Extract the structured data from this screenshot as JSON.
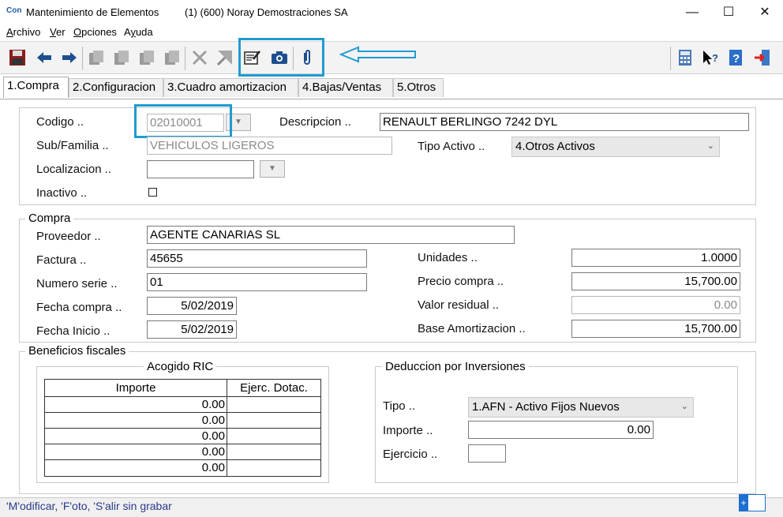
{
  "window": {
    "app_icon_text": "Con",
    "title": "Mantenimiento de Elementos",
    "company": "(1)    (600) Noray Demostraciones SA",
    "minimize": "—",
    "maximize": "☐",
    "close": "✕"
  },
  "menu": {
    "items": [
      {
        "label": "Archivo",
        "underline": "A"
      },
      {
        "label": "Ver",
        "underline": "V"
      },
      {
        "label": "Opciones",
        "underline": "O"
      },
      {
        "label": "Ayuda",
        "underline": "y"
      }
    ]
  },
  "toolbar": {
    "buttons": [
      "save-icon",
      "back-arrow-icon",
      "forward-arrow-icon",
      "copy-doc-icon",
      "copy-doc-icon",
      "copy-doc-icon",
      "copy-doc-icon",
      "delete-x-icon",
      "expand-icon",
      "edit-form-icon",
      "camera-icon",
      "paperclip-icon",
      "calculator-icon",
      "help-cursor-icon",
      "help-book-icon",
      "exit-door-icon"
    ],
    "accent": "#1f9bd1"
  },
  "tabs": [
    {
      "label": "1.Compra",
      "active": true
    },
    {
      "label": "2.Configuracion",
      "active": false
    },
    {
      "label": "3.Cuadro amortizacion",
      "active": false
    },
    {
      "label": "4.Bajas/Ventas",
      "active": false
    },
    {
      "label": "5.Otros",
      "active": false
    }
  ],
  "general": {
    "codigo_label": "Codigo ..",
    "codigo_value": "02010001",
    "descripcion_label": "Descripcion ..",
    "descripcion_value": "RENAULT BERLINGO 7242 DYL",
    "subfamilia_label": "Sub/Familia ..",
    "subfamilia_value": "VEHICULOS LIGEROS",
    "tipo_activo_label": "Tipo Activo ..",
    "tipo_activo_value": "4.Otros Activos",
    "localizacion_label": "Localizacion ..",
    "localizacion_value": "",
    "inactivo_label": "Inactivo .."
  },
  "compra": {
    "title": "Compra",
    "proveedor_label": "Proveedor ..",
    "proveedor_value": "AGENTE CANARIAS SL",
    "factura_label": "Factura ..",
    "factura_value": "45655",
    "numero_serie_label": "Numero serie ..",
    "numero_serie_value": "01",
    "fecha_compra_label": "Fecha compra ..",
    "fecha_compra_value": "5/02/2019",
    "fecha_inicio_label": "Fecha Inicio ..",
    "fecha_inicio_value": "5/02/2019",
    "unidades_label": "Unidades ..",
    "unidades_value": "1.0000",
    "precio_compra_label": "Precio compra ..",
    "precio_compra_value": "15,700.00",
    "valor_residual_label": "Valor residual ..",
    "valor_residual_value": "0.00",
    "base_amortizacion_label": "Base Amortizacion ..",
    "base_amortizacion_value": "15,700.00"
  },
  "beneficios": {
    "title": "Beneficios fiscales",
    "ric_title": "Acogido RIC",
    "ric_col_importe": "Importe",
    "ric_col_ejerc": "Ejerc. Dotac.",
    "ric_rows": [
      {
        "importe": "0.00",
        "ejerc": ""
      },
      {
        "importe": "0.00",
        "ejerc": ""
      },
      {
        "importe": "0.00",
        "ejerc": ""
      },
      {
        "importe": "0.00",
        "ejerc": ""
      },
      {
        "importe": "0.00",
        "ejerc": ""
      }
    ],
    "deduccion_title": "Deduccion por Inversiones",
    "tipo_label": "Tipo ..",
    "tipo_value": "1.AFN - Activo Fijos Nuevos",
    "importe_label": "Importe ..",
    "importe_value": "0.00",
    "ejercicio_label": "Ejercicio ..",
    "ejercicio_value": ""
  },
  "status": {
    "text": "'M'odificar, 'F'oto, 'S'alir sin grabar",
    "plus": "+"
  }
}
